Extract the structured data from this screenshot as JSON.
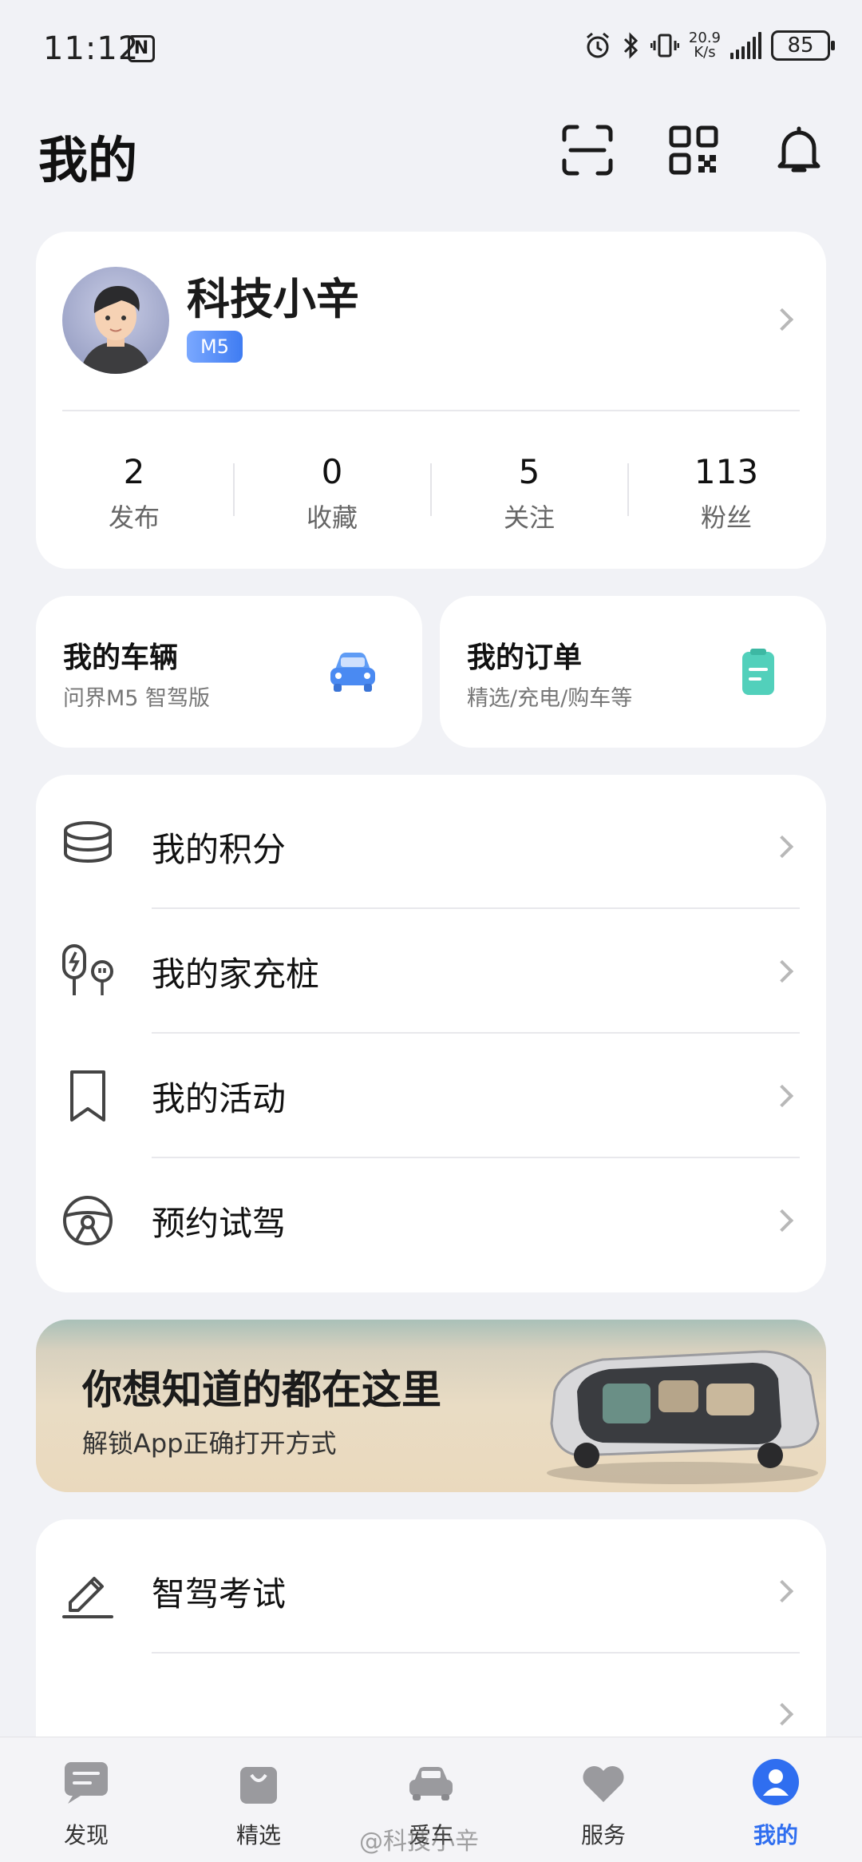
{
  "status_bar": {
    "time": "11:12",
    "nfc": "N",
    "speed_top": "20.9",
    "speed_bottom": "K/s",
    "battery": "85"
  },
  "header": {
    "title": "我的"
  },
  "profile": {
    "name": "科技小辛",
    "badge": "M5",
    "stats": [
      {
        "value": "2",
        "label": "发布"
      },
      {
        "value": "0",
        "label": "收藏"
      },
      {
        "value": "5",
        "label": "关注"
      },
      {
        "value": "113",
        "label": "粉丝"
      }
    ]
  },
  "shortcuts": {
    "vehicle": {
      "title": "我的车辆",
      "subtitle": "问界M5 智驾版",
      "icon": "car-icon"
    },
    "orders": {
      "title": "我的订单",
      "subtitle": "精选/充电/购车等",
      "icon": "order-icon"
    }
  },
  "menu": [
    {
      "label": "我的积分",
      "icon": "coins-icon"
    },
    {
      "label": "我的家充桩",
      "icon": "charger-icon"
    },
    {
      "label": "我的活动",
      "icon": "bookmark-icon"
    },
    {
      "label": "预约试驾",
      "icon": "steering-wheel-icon"
    }
  ],
  "banner": {
    "title": "你想知道的都在这里",
    "subtitle": "解锁App正确打开方式"
  },
  "menu2": [
    {
      "label": "智驾考试",
      "icon": "pencil-icon"
    }
  ],
  "nav": [
    {
      "label": "发现",
      "icon": "discover-icon"
    },
    {
      "label": "精选",
      "icon": "shopping-bag-icon"
    },
    {
      "label": "爱车",
      "icon": "car-icon"
    },
    {
      "label": "服务",
      "icon": "heart-icon"
    },
    {
      "label": "我的",
      "icon": "user-icon",
      "active": true
    }
  ],
  "watermark": "@科技小辛",
  "colors": {
    "accent": "#2f6ef0",
    "card": "#ffffff",
    "background": "#f1f2f6"
  }
}
